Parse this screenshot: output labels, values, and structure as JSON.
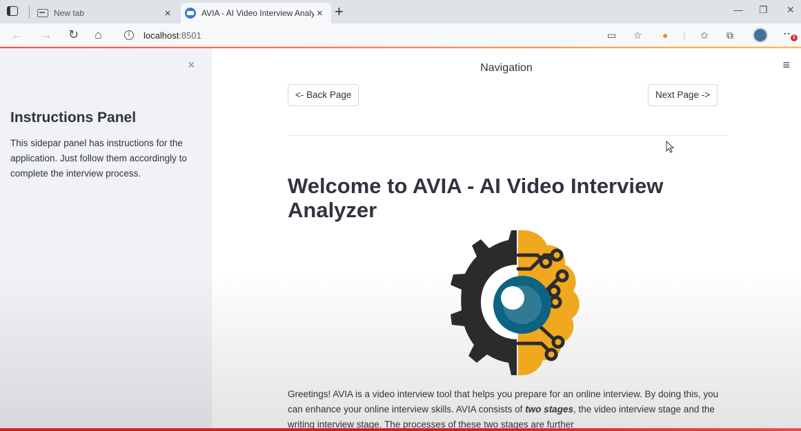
{
  "browser": {
    "tabs": [
      {
        "title": "New tab",
        "active": false,
        "icon": "newtab-icon"
      },
      {
        "title": "AVIA - AI Video Interview Analyz",
        "active": true,
        "icon": "avia-favicon"
      }
    ],
    "close_glyph": "×",
    "new_tab_glyph": "+",
    "url_host": "localhost",
    "url_port": ":8501",
    "notification_count": "1"
  },
  "sidebar": {
    "close_glyph": "×",
    "title": "Instructions Panel",
    "text": "This sidepar panel has instructions for the application. Just follow them accordingly to complete the interview process."
  },
  "main": {
    "menu_glyph": "≡",
    "nav_heading": "Navigation",
    "back_label": "<- Back Page",
    "next_label": "Next Page ->",
    "title": "Welcome to AVIA - AI Video Interview Analyzer",
    "paragraph_1": "Greetings! AVIA is a video interview tool that helps you prepare for an online interview. By doing this, you can enhance your online interview skills. AVIA consists of ",
    "paragraph_bold": "two stages",
    "paragraph_2": ", the video interview stage and the writing interview stage. The processes of these two stages are further"
  },
  "colors": {
    "accent_red": "#ff4b4b",
    "accent_yellow": "#ffbd45",
    "logo_gear": "#2b2b2b",
    "logo_brain": "#f0a81f",
    "logo_eye": "#0d6382"
  }
}
